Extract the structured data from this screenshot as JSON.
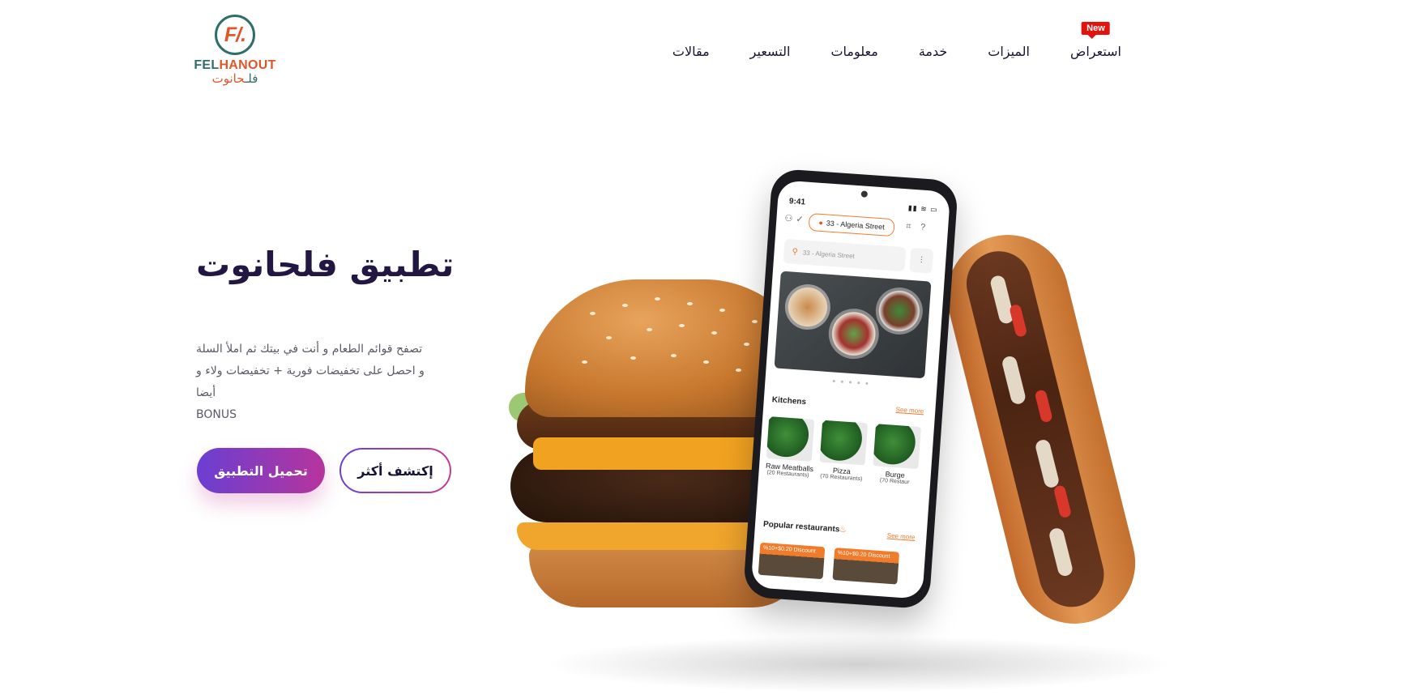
{
  "logo": {
    "mark": "F/.",
    "name_part1": "FEL",
    "name_part2": "HANOUT",
    "arabic_part1": "فلـ",
    "arabic_part2": "حانوت"
  },
  "nav": {
    "items": [
      "مقالات",
      "التسعير",
      "معلومات",
      "خدمة",
      "الميزات",
      "استعراض"
    ],
    "badge": "New"
  },
  "hero": {
    "title": "تطبيق فلحانوت",
    "desc_line1": "تصفح قوائم الطعام و أنت في بيتك ثم املأ السلة",
    "desc_line2": "و احصل على تخفيضات فورية + تخفيضات ولاء و أيضا",
    "desc_line3": "BONUS",
    "download_button": "تحميل التطبيق",
    "more_button": "إكتشف أكثر"
  },
  "phone": {
    "time": "9:41",
    "status_icons": "▮▮ ≋ ▭",
    "location": "33 - Algeria Street",
    "search_placeholder": "33 - Algeria Street",
    "carousel_dots": "● ● ● ● ●",
    "kitchens_title": "Kitchens",
    "see_more": "See more",
    "kitchens": [
      {
        "name": "Raw Meatballs",
        "count": "(20 Restaurants)"
      },
      {
        "name": "Pizza",
        "count": "(70 Restaurants)"
      },
      {
        "name": "Burge",
        "count": "(70 Restaur"
      }
    ],
    "popular_title": "Popular restaurants",
    "popular_see_more": "See more",
    "promos": [
      "%10+$0.20 Discount",
      "%10+$0.20 Discount"
    ]
  },
  "colors": {
    "brand_teal": "#2f6e6a",
    "brand_orange": "#e2552b",
    "button_gradient_start": "#6a3fd2",
    "button_gradient_end": "#b7349d",
    "badge_red": "#e3120b"
  }
}
